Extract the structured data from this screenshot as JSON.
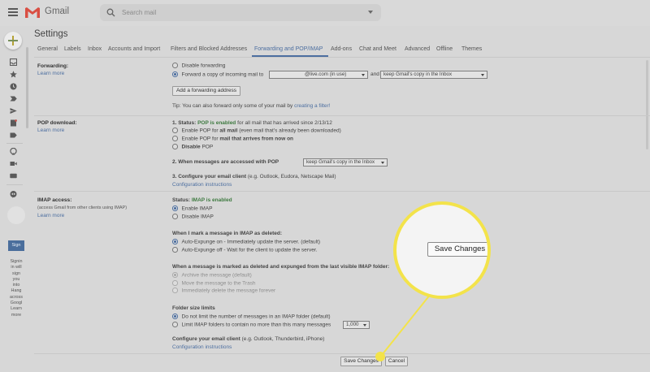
{
  "header": {
    "app_name": "Gmail",
    "search_placeholder": "Search mail"
  },
  "rail": {
    "sign_label": "Sign",
    "side_text": "Signin\nin will\nsign\nyou\ninto\nHang\nacross\nGoogl\nLearn\nmore"
  },
  "settings": {
    "title": "Settings",
    "tabs": [
      "General",
      "Labels",
      "Inbox",
      "Accounts and Import",
      "Filters and Blocked Addresses",
      "Forwarding and POP/IMAP",
      "Add-ons",
      "Chat and Meet",
      "Advanced",
      "Offline",
      "Themes"
    ],
    "active_tab": "Forwarding and POP/IMAP"
  },
  "forwarding": {
    "title": "Forwarding:",
    "learn_more": "Learn more",
    "disable_label": "Disable forwarding",
    "forward_label": "Forward a copy of incoming mail to",
    "forward_address": "@live.com (in use)",
    "and_label": "and",
    "keep_copy": "keep Gmail's copy in the Inbox",
    "add_address_button": "Add a forwarding address",
    "tip_text": "Tip: You can also forward only some of your mail by",
    "tip_link": "creating a filter!"
  },
  "pop": {
    "title": "POP download:",
    "learn_more": "Learn more",
    "status_prefix": "1. Status:",
    "status_value": "POP is enabled",
    "status_suffix": "for all mail that has arrived since 2/13/12",
    "opt1_a": "Enable POP for",
    "opt1_b": "all mail",
    "opt1_c": "(even mail that's already been downloaded)",
    "opt2_a": "Enable POP for",
    "opt2_b": "mail that arrives from now on",
    "opt3_a": "Disable",
    "opt3_b": "POP",
    "when_accessed": "2. When messages are accessed with POP",
    "when_accessed_value": "keep Gmail's copy in the Inbox",
    "configure_a": "3. Configure your email client",
    "configure_b": "(e.g. Outlook, Eudora, Netscape Mail)",
    "config_link": "Configuration instructions"
  },
  "imap": {
    "title": "IMAP access:",
    "subtitle": "(access Gmail from other clients using IMAP)",
    "learn_more": "Learn more",
    "status_prefix": "Status:",
    "status_value": "IMAP is enabled",
    "enable_label": "Enable IMAP",
    "disable_label": "Disable IMAP",
    "deleted_heading": "When I mark a message in IMAP as deleted:",
    "expunge_on": "Auto-Expunge on - Immediately update the server. (default)",
    "expunge_off": "Auto-Expunge off - Wait for the client to update the server.",
    "expunged_heading": "When a message is marked as deleted and expunged from the last visible IMAP folder:",
    "archive_label": "Archive the message (default)",
    "trash_label": "Move the message to the Trash",
    "delete_label": "Immediately delete the message forever",
    "folder_heading": "Folder size limits",
    "no_limit_label": "Do not limit the number of messages in an IMAP folder (default)",
    "limit_label": "Limit IMAP folders to contain no more than this many messages",
    "limit_value": "1,000",
    "configure_heading": "Configure your email client",
    "configure_note": "(e.g. Outlook, Thunderbird, iPhone)",
    "config_link": "Configuration instructions"
  },
  "footer": {
    "save_label": "Save Changes",
    "cancel_label": "Cancel"
  },
  "callout": {
    "save_label": "Save Changes",
    "highlight_color": "#f3e34a"
  }
}
